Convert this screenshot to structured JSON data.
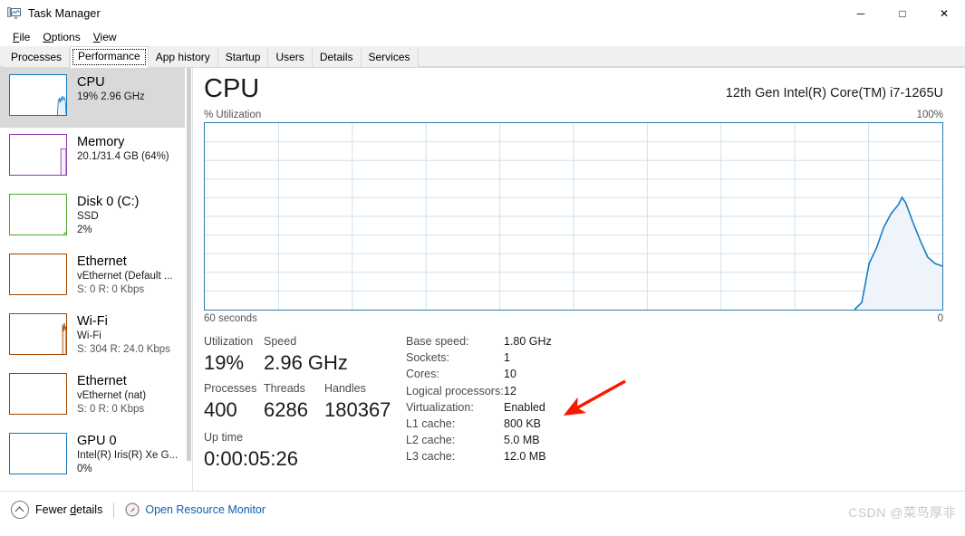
{
  "window": {
    "title": "Task Manager",
    "icon": "task-manager-icon",
    "minimize": "─",
    "maximize": "□",
    "close": "✕"
  },
  "menu": {
    "items": [
      {
        "label": "File",
        "accel": "F"
      },
      {
        "label": "Options",
        "accel": "O"
      },
      {
        "label": "View",
        "accel": "V"
      }
    ]
  },
  "tabs": {
    "items": [
      {
        "label": "Processes",
        "selected": false
      },
      {
        "label": "Performance",
        "selected": true
      },
      {
        "label": "App history",
        "selected": false
      },
      {
        "label": "Startup",
        "selected": false
      },
      {
        "label": "Users",
        "selected": false
      },
      {
        "label": "Details",
        "selected": false
      },
      {
        "label": "Services",
        "selected": false
      }
    ]
  },
  "sidebar": {
    "items": [
      {
        "title": "CPU",
        "sub1": "19%  2.96 GHz",
        "sub2": "",
        "color": "#1177bb",
        "selected": true
      },
      {
        "title": "Memory",
        "sub1": "20.1/31.4 GB (64%)",
        "sub2": "",
        "color": "#8f3aa8",
        "selected": false
      },
      {
        "title": "Disk 0 (C:)",
        "sub1": "SSD",
        "sub2": "2%",
        "color": "#4ea72e",
        "selected": false
      },
      {
        "title": "Ethernet",
        "sub1": "vEthernet (Default ...",
        "sub2": "S: 0 R: 0 Kbps",
        "color": "#a34700",
        "selected": false
      },
      {
        "title": "Wi-Fi",
        "sub1": "Wi-Fi",
        "sub2": "S: 304 R: 24.0 Kbps",
        "color": "#a34700",
        "selected": false
      },
      {
        "title": "Ethernet",
        "sub1": "vEthernet (nat)",
        "sub2": "S: 0 R: 0 Kbps",
        "color": "#a34700",
        "selected": false
      },
      {
        "title": "GPU 0",
        "sub1": "Intel(R) Iris(R) Xe G...",
        "sub2": "0%",
        "color": "#1177bb",
        "selected": false
      }
    ]
  },
  "main": {
    "title": "CPU",
    "device": "12th Gen Intel(R) Core(TM) i7-1265U",
    "graph": {
      "y_label": "% Utilization",
      "y_max_label": "100%",
      "y_min_label": "0",
      "x_label": "60 seconds",
      "line_color": "#1a7fc1",
      "fill_color": "#eaf2f9",
      "grid_color": "#cfe2ef"
    },
    "stats": {
      "utilization_label": "Utilization",
      "utilization_value": "19%",
      "speed_label": "Speed",
      "speed_value": "2.96 GHz",
      "processes_label": "Processes",
      "processes_value": "400",
      "threads_label": "Threads",
      "threads_value": "6286",
      "handles_label": "Handles",
      "handles_value": "180367",
      "uptime_label": "Up time",
      "uptime_value": "0:00:05:26"
    },
    "details": [
      {
        "key": "Base speed:",
        "value": "1.80 GHz"
      },
      {
        "key": "Sockets:",
        "value": "1"
      },
      {
        "key": "Cores:",
        "value": "10"
      },
      {
        "key": "Logical processors:",
        "value": "12"
      },
      {
        "key": "Virtualization:",
        "value": "Enabled"
      },
      {
        "key": "L1 cache:",
        "value": "800 KB"
      },
      {
        "key": "L2 cache:",
        "value": "5.0 MB"
      },
      {
        "key": "L3 cache:",
        "value": "12.0 MB"
      }
    ]
  },
  "footer": {
    "fewer_details": "Fewer details",
    "fewer_details_accel": "d",
    "open_resource_monitor": "Open Resource Monitor",
    "watermark": "CSDN @菜鸟厚非"
  },
  "annotation": {
    "arrow_color": "#fa1900",
    "points_at": "Enabled"
  },
  "chart_data": {
    "type": "area",
    "title": "CPU % Utilization",
    "xlabel": "60 seconds",
    "ylabel": "% Utilization",
    "ylim": [
      0,
      100
    ],
    "xlim": [
      0,
      60
    ],
    "grid": true,
    "legend": false,
    "series": [
      {
        "name": "CPU utilization",
        "x": [
          0,
          44,
          45,
          47,
          49,
          51,
          53,
          55,
          56,
          57,
          58,
          59,
          60
        ],
        "values": [
          0,
          0,
          4,
          20,
          33,
          44,
          52,
          58,
          60,
          52,
          42,
          32,
          28
        ]
      }
    ]
  }
}
